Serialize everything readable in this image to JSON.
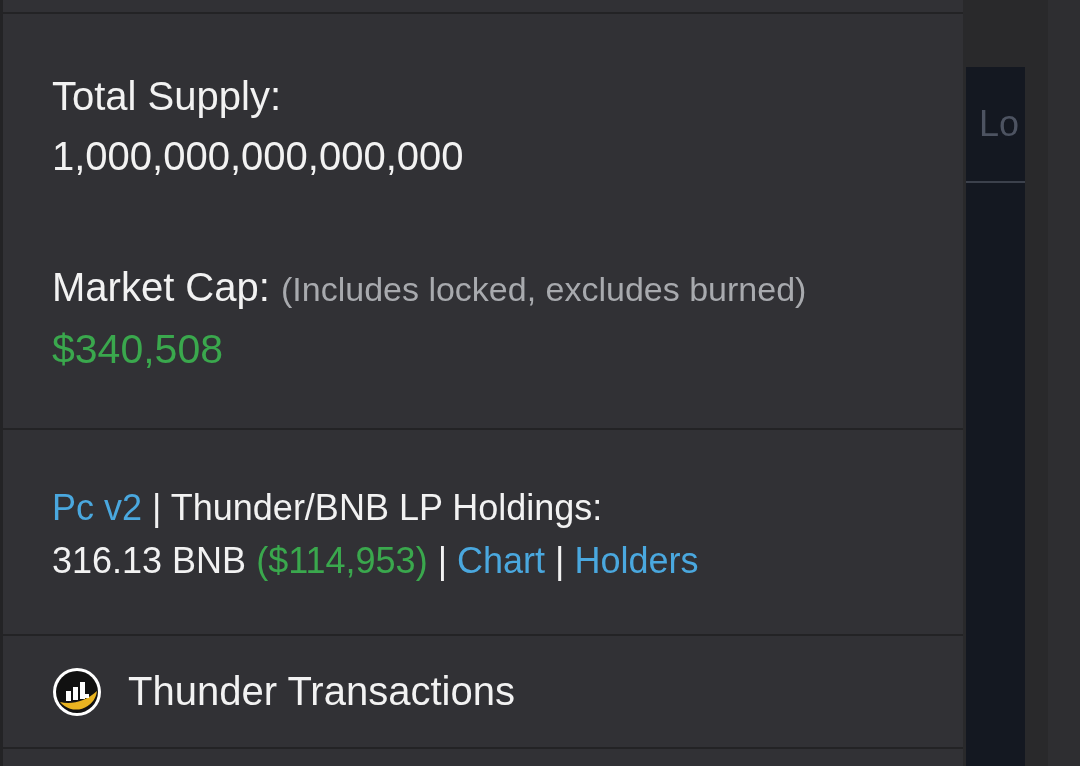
{
  "supply_card": {
    "total_supply": {
      "label": "Total Supply:",
      "value": "1,000,000,000,000,000"
    },
    "market_cap": {
      "label": "Market Cap:",
      "note": "(Includes locked, excludes burned)",
      "value": "$340,508"
    }
  },
  "lp_card": {
    "lines": [
      {
        "segments": [
          {
            "kind": "link",
            "text": "Pc v2"
          },
          {
            "kind": "separator",
            "text": "|"
          },
          {
            "kind": "plain",
            "text": "Thunder/BNB LP Holdings:"
          }
        ]
      },
      {
        "segments": [
          {
            "kind": "plain",
            "text": "316.13 BNB"
          },
          {
            "kind": "positive",
            "text": "($114,953)"
          },
          {
            "kind": "separator",
            "text": "|"
          },
          {
            "kind": "link",
            "text": "Chart"
          },
          {
            "kind": "separator",
            "text": "|"
          },
          {
            "kind": "link",
            "text": "Holders"
          }
        ]
      }
    ]
  },
  "transactions_card": {
    "title": "Thunder Transactions"
  },
  "side_panel": {
    "header": "Lo"
  }
}
